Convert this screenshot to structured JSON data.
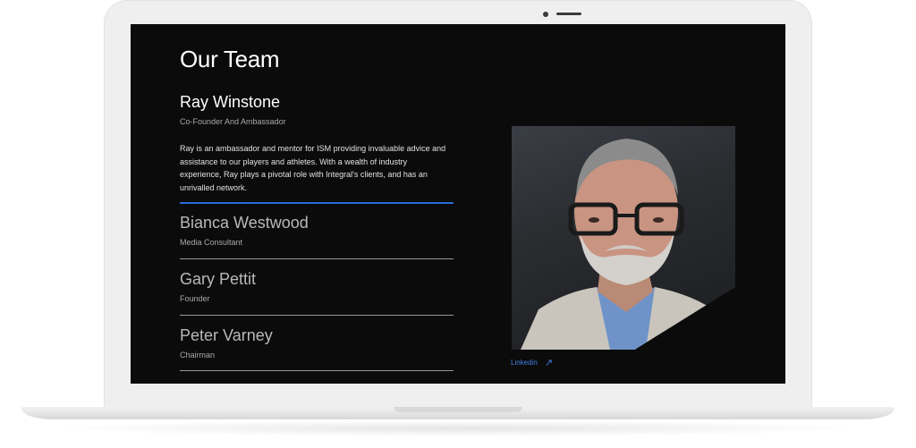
{
  "section": {
    "title": "Our Team"
  },
  "active_member": {
    "name": "Ray Winstone",
    "role": "Co-Founder And Ambassador",
    "bio": "Ray is an ambassador and mentor for ISM providing invaluable advice and assistance to our players and athletes. With a wealth of industry experience, Ray plays a pivotal role with Integral's clients, and has an unrivalled network.",
    "link_label": "Linkedin"
  },
  "members": [
    {
      "name": "Bianca Westwood",
      "role": "Media Consultant"
    },
    {
      "name": "Gary Pettit",
      "role": "Founder"
    },
    {
      "name": "Peter Varney",
      "role": "Chairman"
    }
  ],
  "colors": {
    "accent": "#2b6bd6",
    "background": "#0b0b0b",
    "link": "#3d7fe0"
  }
}
